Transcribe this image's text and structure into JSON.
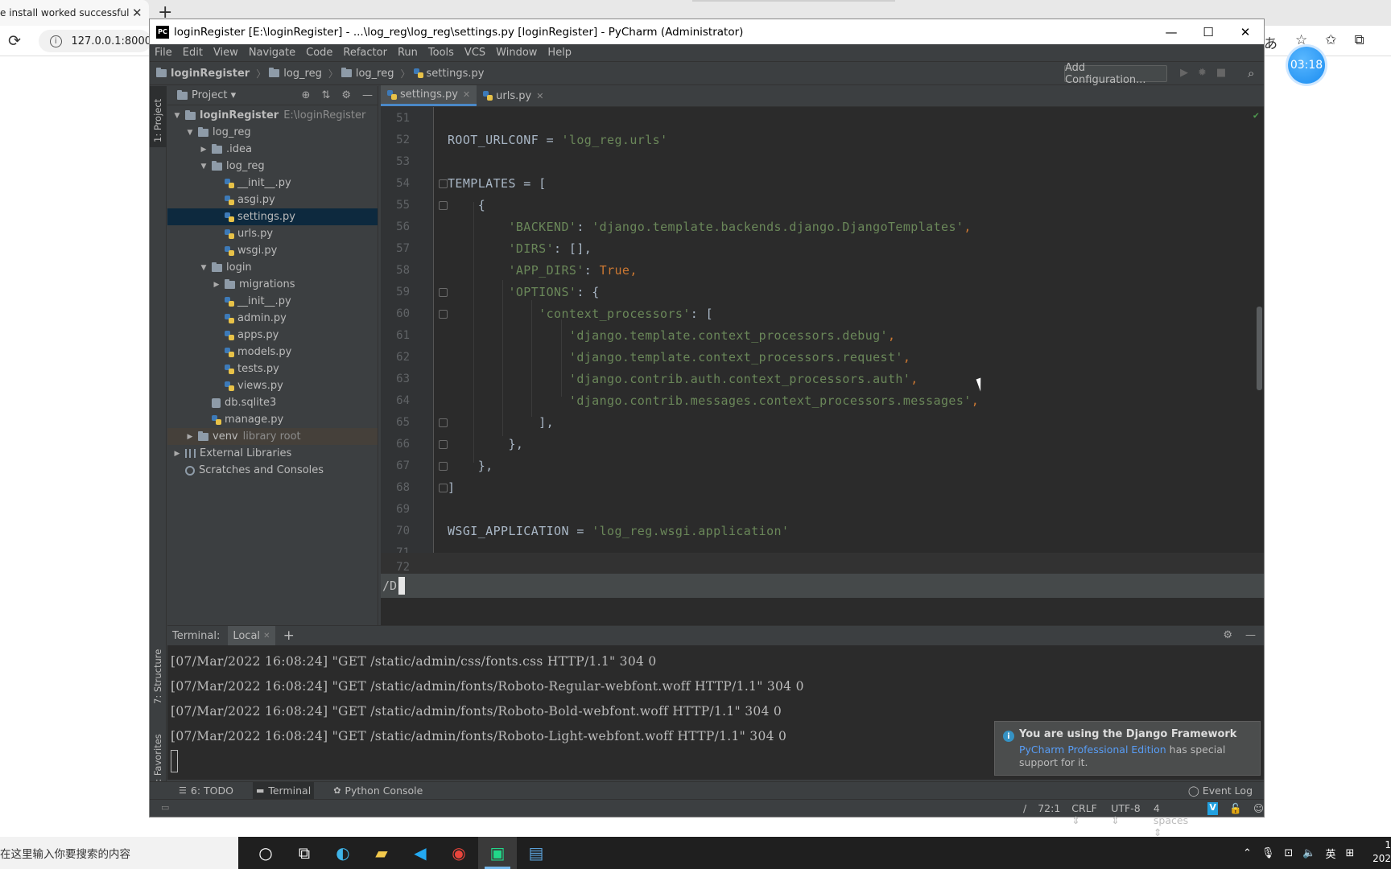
{
  "browser": {
    "tab_title": "e install worked successfully! C",
    "tab_close": "✕",
    "new_tab": "+",
    "url": "127.0.0.1:8000",
    "timer": "03:18"
  },
  "window": {
    "title": "loginRegister [E:\\loginRegister] - ...\\log_reg\\log_reg\\settings.py [loginRegister] - PyCharm (Administrator)",
    "logo": "PC"
  },
  "menu": [
    "File",
    "Edit",
    "View",
    "Navigate",
    "Code",
    "Refactor",
    "Run",
    "Tools",
    "VCS",
    "Window",
    "Help"
  ],
  "breadcrumbs": [
    "loginRegister",
    "log_reg",
    "log_reg",
    "settings.py"
  ],
  "toolbar": {
    "add_config": "Add Configuration..."
  },
  "left_strip": {
    "project": "1: Project",
    "structure": "7: Structure",
    "favorites": "2: Favorites"
  },
  "project_panel": {
    "title": "Project",
    "tree": [
      {
        "label": "loginRegister",
        "extra": "E:\\loginRegister"
      },
      {
        "label": "log_reg"
      },
      {
        "label": ".idea"
      },
      {
        "label": "log_reg"
      },
      {
        "label": "__init__.py"
      },
      {
        "label": "asgi.py"
      },
      {
        "label": "settings.py"
      },
      {
        "label": "urls.py"
      },
      {
        "label": "wsgi.py"
      },
      {
        "label": "login"
      },
      {
        "label": "migrations"
      },
      {
        "label": "__init__.py"
      },
      {
        "label": "admin.py"
      },
      {
        "label": "apps.py"
      },
      {
        "label": "models.py"
      },
      {
        "label": "tests.py"
      },
      {
        "label": "views.py"
      },
      {
        "label": "db.sqlite3"
      },
      {
        "label": "manage.py"
      },
      {
        "label": "venv",
        "extra": "library root"
      },
      {
        "label": "External Libraries"
      },
      {
        "label": "Scratches and Consoles"
      }
    ]
  },
  "editor": {
    "tabs": [
      {
        "label": "settings.py",
        "active": true
      },
      {
        "label": "urls.py",
        "active": false
      }
    ],
    "line_numbers": [
      "51",
      "52",
      "53",
      "54",
      "55",
      "56",
      "57",
      "58",
      "59",
      "60",
      "61",
      "62",
      "63",
      "64",
      "65",
      "66",
      "67",
      "68",
      "69",
      "70",
      "71",
      "72"
    ],
    "code": {
      "l52a": "ROOT_URLCONF = ",
      "l52b": "'log_reg.urls'",
      "l54": "TEMPLATES = [",
      "l55": "    {",
      "l56a": "        'BACKEND'",
      "l56b": ": ",
      "l56c": "'django.template.backends.django.DjangoTemplates'",
      "l56d": ",",
      "l57a": "        'DIRS'",
      "l57b": ": [],",
      "l58a": "        'APP_DIRS'",
      "l58b": ": ",
      "l58c": "True",
      "l58d": ",",
      "l59a": "        'OPTIONS'",
      "l59b": ": {",
      "l60a": "            'context_processors'",
      "l60b": ": [",
      "l61a": "                'django.template.context_processors.debug'",
      "l61b": ",",
      "l62a": "                'django.template.context_processors.request'",
      "l62b": ",",
      "l63a": "                'django.contrib.auth.context_processors.auth'",
      "l63b": ",",
      "l64a": "                'django.contrib.messages.context_processors.messages'",
      "l64b": ",",
      "l65": "            ],",
      "l66": "        },",
      "l67": "    },",
      "l68": "]",
      "l70a": "WSGI_APPLICATION = ",
      "l70b": "'log_reg.wsgi.application'"
    },
    "search_input": "/D"
  },
  "terminal": {
    "label": "Terminal:",
    "tab": "Local",
    "tab_close": "✕",
    "add": "+",
    "lines": [
      "[07/Mar/2022 16:08:24] \"GET /static/admin/css/fonts.css HTTP/1.1\" 304 0",
      "[07/Mar/2022 16:08:24] \"GET /static/admin/fonts/Roboto-Regular-webfont.woff HTTP/1.1\" 304 0",
      "[07/Mar/2022 16:08:24] \"GET /static/admin/fonts/Roboto-Bold-webfont.woff HTTP/1.1\" 304 0",
      "[07/Mar/2022 16:08:24] \"GET /static/admin/fonts/Roboto-Light-webfont.woff HTTP/1.1\" 304 0"
    ]
  },
  "notification": {
    "title": "You are using the Django Framework",
    "link": "PyCharm Professional Edition",
    "body": " has special support for it."
  },
  "bottom_tools": {
    "todo": "6: TODO",
    "terminal": "Terminal",
    "python_console": "Python Console",
    "event_log": "Event Log"
  },
  "status": {
    "slash": "/",
    "position": "72:1",
    "line_sep": "CRLF ⇕",
    "encoding": "UTF-8 ⇕",
    "indent": "4 spaces ⇕",
    "v_badge": "V"
  },
  "taskbar": {
    "search_placeholder": "在这里输入你要搜索的内容",
    "ime": "英",
    "clock_time": "1",
    "clock_date": "202"
  }
}
